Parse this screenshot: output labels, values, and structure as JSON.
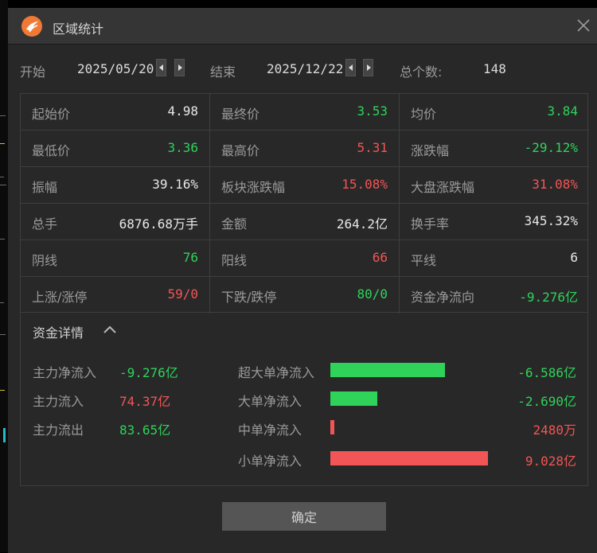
{
  "window": {
    "title": "区域统计",
    "logo_icon": "app-logo-icon",
    "close_icon": "close-icon"
  },
  "range": {
    "start_label": "开始",
    "start_date": "2025/05/20",
    "end_label": "结束",
    "end_date": "2025/12/22",
    "count_label": "总个数:",
    "count_value": "148"
  },
  "colors": {
    "up": "#f25555",
    "down": "#2fd35a",
    "neutral": "#e8e8e8",
    "bg": "#282828"
  },
  "stats": [
    [
      {
        "label": "起始价",
        "value": "4.98",
        "tone": "neutral"
      },
      {
        "label": "最终价",
        "value": "3.53",
        "tone": "down"
      },
      {
        "label": "均价",
        "value": "3.84",
        "tone": "down"
      }
    ],
    [
      {
        "label": "最低价",
        "value": "3.36",
        "tone": "down"
      },
      {
        "label": "最高价",
        "value": "5.31",
        "tone": "up"
      },
      {
        "label": "涨跌幅",
        "value": "-29.12%",
        "tone": "down"
      }
    ],
    [
      {
        "label": "振幅",
        "value": "39.16%",
        "tone": "neutral"
      },
      {
        "label": "板块涨跌幅",
        "value": "15.08%",
        "tone": "up"
      },
      {
        "label": "大盘涨跌幅",
        "value": "31.08%",
        "tone": "up"
      }
    ],
    [
      {
        "label": "总手",
        "value": "6876.68万手",
        "tone": "neutral"
      },
      {
        "label": "金额",
        "value": "264.2亿",
        "tone": "neutral"
      },
      {
        "label": "换手率",
        "value": "345.32%",
        "tone": "neutral"
      }
    ],
    [
      {
        "label": "阴线",
        "value": "76",
        "tone": "down"
      },
      {
        "label": "阳线",
        "value": "66",
        "tone": "up"
      },
      {
        "label": "平线",
        "value": "6",
        "tone": "neutral"
      }
    ],
    [
      {
        "label": "上涨/涨停",
        "value": "59/0",
        "tone": "up"
      },
      {
        "label": "下跌/跌停",
        "value": "80/0",
        "tone": "down"
      },
      {
        "label": "资金净流向",
        "value": "-9.276亿",
        "tone": "down"
      }
    ]
  ],
  "details": {
    "title": "资金详情",
    "toggle_icon": "chevron-up-icon",
    "main": [
      {
        "label": "主力净流入",
        "value": "-9.276亿",
        "tone": "down"
      },
      {
        "label": "主力流入",
        "value": "74.37亿",
        "tone": "up"
      },
      {
        "label": "主力流出",
        "value": "83.65亿",
        "tone": "down"
      }
    ],
    "orders": [
      {
        "label": "超大单净流入",
        "value": "-6.586亿",
        "amount_yi": -6.586,
        "tone": "down"
      },
      {
        "label": "大单净流入",
        "value": "-2.690亿",
        "amount_yi": -2.69,
        "tone": "down"
      },
      {
        "label": "中单净流入",
        "value": "2480万",
        "amount_yi": 0.248,
        "tone": "up"
      },
      {
        "label": "小单净流入",
        "value": "9.028亿",
        "amount_yi": 9.028,
        "tone": "up"
      }
    ]
  },
  "buttons": {
    "ok_label": "确定"
  }
}
